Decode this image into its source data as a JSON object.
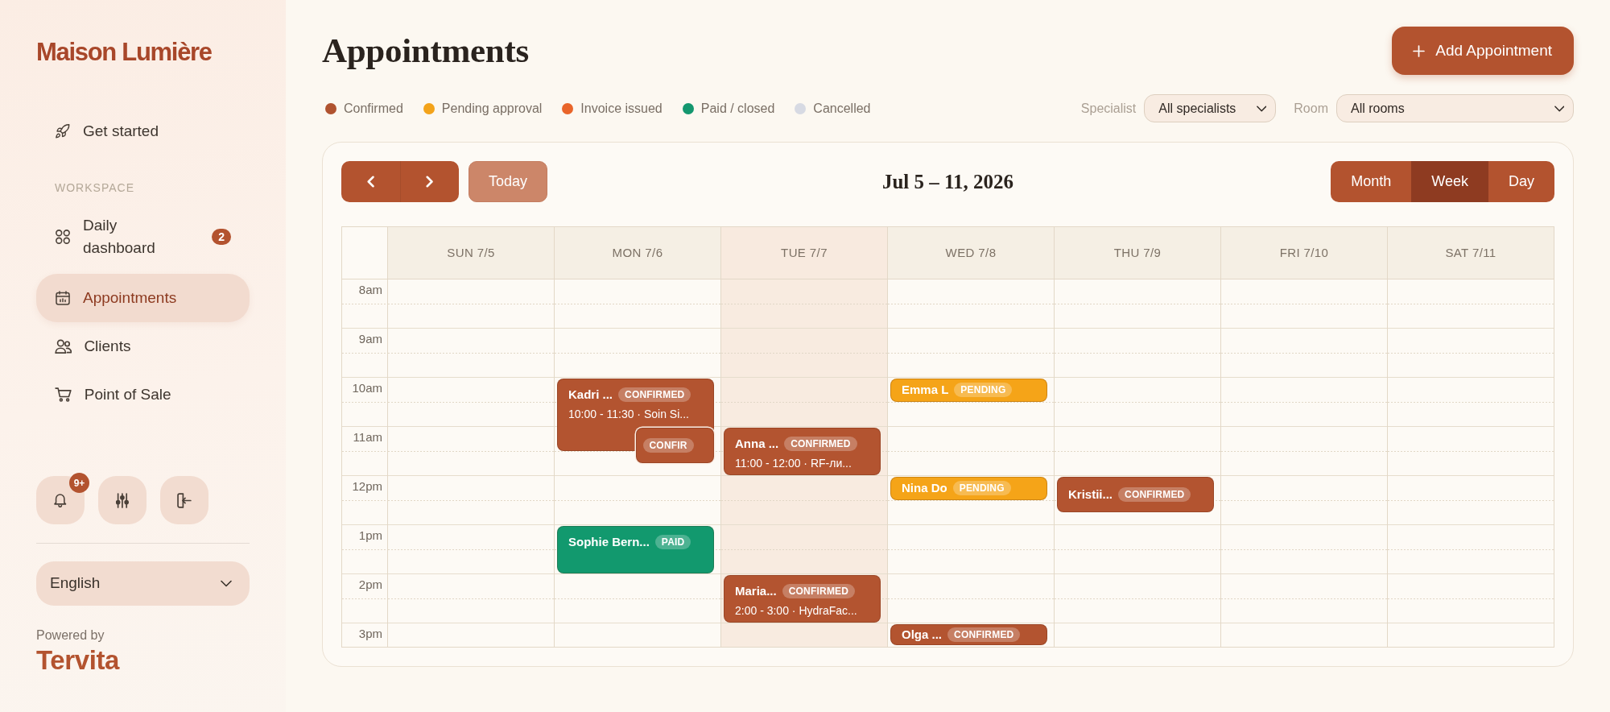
{
  "sidebar": {
    "logo": "Maison Lumière",
    "items": [
      {
        "label": "Get started",
        "selected": false
      }
    ],
    "sections": [
      {
        "heading": "WORKSPACE",
        "items": [
          {
            "label": "Daily dashboard",
            "badge": "2",
            "selected": false
          },
          {
            "label": "Appointments",
            "selected": true
          },
          {
            "label": "Clients",
            "selected": false
          },
          {
            "label": "Point of Sale",
            "selected": false
          }
        ]
      }
    ],
    "notification_badge": "9+",
    "language": "English",
    "powered_by": "Powered by",
    "brand": "Tervita"
  },
  "header": {
    "title": "Appointments",
    "add_button": "Add Appointment"
  },
  "legend": [
    {
      "label": "Confirmed",
      "color": "#b0532f"
    },
    {
      "label": "Pending approval",
      "color": "#f3a31a"
    },
    {
      "label": "Invoice issued",
      "color": "#e9652a"
    },
    {
      "label": "Paid / closed",
      "color": "#14976f"
    },
    {
      "label": "Cancelled",
      "color": "#d7dae3"
    }
  ],
  "filters": [
    {
      "label": "Specialist",
      "value": "All specialists"
    },
    {
      "label": "Room",
      "value": "All rooms"
    }
  ],
  "calendar": {
    "today_button": {
      "label": "Today",
      "disabled": true
    },
    "range_title": "Jul 5 – 11, 2026",
    "views": [
      {
        "label": "Month",
        "selected": false
      },
      {
        "label": "Week",
        "selected": true
      },
      {
        "label": "Day",
        "selected": false
      }
    ],
    "days": [
      {
        "label": "SUN 7/5",
        "today": false
      },
      {
        "label": "MON 7/6",
        "today": false
      },
      {
        "label": "TUE 7/7",
        "today": true
      },
      {
        "label": "WED 7/8",
        "today": false
      },
      {
        "label": "THU 7/9",
        "today": false
      },
      {
        "label": "FRI 7/10",
        "today": false
      },
      {
        "label": "SAT 7/11",
        "today": false
      }
    ],
    "rows": [
      {
        "time": "8am"
      },
      {
        "time": "9am"
      },
      {
        "time": "10am",
        "cells": [
          null,
          [
            {
              "name": "Kadri ...",
              "status": "CONFIRMED",
              "detail": "10:00 - 11:30 · Soin Si...",
              "kind": "long",
              "color": "#b35430"
            }
          ],
          null,
          [
            {
              "name": "Emma L",
              "status": "PENDING",
              "kind": "short",
              "color": "#f5a418"
            }
          ]
        ]
      },
      {
        "time": "11am",
        "cells": [
          null,
          [
            {
              "status": "CONFIR",
              "kind": "medium",
              "color": "#b35430"
            }
          ],
          [
            {
              "name": "Anna ...",
              "status": "CONFIRMED",
              "detail": "11:00 - 12:00 · RF-ли...",
              "kind": "standard",
              "color": "#b35430"
            }
          ]
        ]
      },
      {
        "time": "12pm",
        "cells": [
          null,
          null,
          null,
          [
            {
              "name": "Nina Do",
              "status": "PENDING",
              "kind": "short",
              "color": "#f5a418"
            }
          ],
          [
            {
              "name": "Kristii...",
              "status": "CONFIRMED",
              "kind": "medium",
              "color": "#b35430"
            }
          ]
        ]
      },
      {
        "time": "1pm",
        "cells": [
          null,
          [
            {
              "name": "Sophie Bern...",
              "status": "PAID",
              "kind": "standard",
              "color": "#12996e"
            }
          ]
        ]
      },
      {
        "time": "2pm",
        "cells": [
          null,
          null,
          [
            {
              "name": "Maria...",
              "status": "CONFIRMED",
              "detail": "2:00 - 3:00 · HydraFac...",
              "kind": "standard",
              "color": "#b35430"
            }
          ]
        ]
      },
      {
        "time": "3pm",
        "cells": [
          null,
          null,
          null,
          [
            {
              "name": "Olga ...",
              "status": "CONFIRMED",
              "kind": "standard",
              "color": "#b35430"
            }
          ]
        ]
      }
    ]
  }
}
